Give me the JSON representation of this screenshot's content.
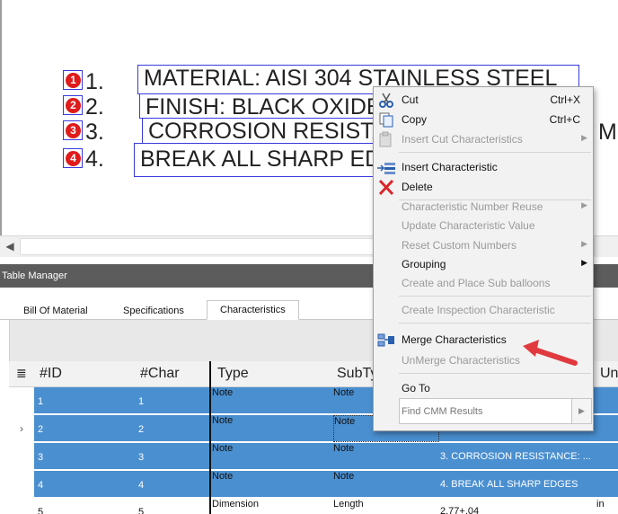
{
  "canvas": {
    "notes": [
      {
        "balloon": "1",
        "number": "1.",
        "text": "MATERIAL:  AISI 304 STAINLESS STEEL"
      },
      {
        "balloon": "2",
        "number": "2.",
        "text": "FINISH: BLACK OXIDE"
      },
      {
        "balloon": "3",
        "number": "3.",
        "text": "CORROSION RESISTANCE:"
      },
      {
        "balloon": "4",
        "number": "4.",
        "text": "BREAK ALL SHARP EDGES"
      }
    ],
    "hidden_tail": "MI"
  },
  "table_manager": {
    "title": "Table Manager",
    "tabs": [
      "Bill Of Material",
      "Specifications",
      "Characteristics"
    ],
    "active_tab": "Characteristics",
    "columns": [
      "#ID",
      "#Char",
      "Type",
      "SubTy",
      "Un"
    ],
    "rows": [
      {
        "id": "1",
        "char": "1",
        "type": "Note",
        "subtype": "Note",
        "text": "",
        "unit": ""
      },
      {
        "id": "2",
        "char": "2",
        "type": "Note",
        "subtype": "Note",
        "text": "",
        "unit": ""
      },
      {
        "id": "3",
        "char": "3",
        "type": "Note",
        "subtype": "Note",
        "text": "3. CORROSION RESISTANCE: ...",
        "unit": ""
      },
      {
        "id": "4",
        "char": "4",
        "type": "Note",
        "subtype": "Note",
        "text": "4. BREAK ALL SHARP EDGES",
        "unit": ""
      },
      {
        "id": "5",
        "char": "5",
        "type": "Dimension",
        "subtype": "Length",
        "text": "2.77+.04",
        "unit": "in"
      }
    ]
  },
  "context_menu": {
    "items": [
      {
        "label": "Cut",
        "shortcut": "Ctrl+X",
        "disabled": false
      },
      {
        "label": "Copy",
        "shortcut": "Ctrl+C",
        "disabled": false
      },
      {
        "label": "Insert Cut Characteristics",
        "disabled": true,
        "submenu": true
      },
      {
        "label": "Insert Characteristic",
        "disabled": false
      },
      {
        "label": "Delete",
        "disabled": false
      },
      {
        "label": "Characteristic Number Reuse",
        "disabled": true,
        "submenu": true
      },
      {
        "label": "Update Characteristic Value",
        "disabled": true
      },
      {
        "label": "Reset Custom Numbers",
        "disabled": true,
        "submenu": true
      },
      {
        "label": "Grouping",
        "disabled": false,
        "submenu": true
      },
      {
        "label": "Create and Place Sub balloons",
        "disabled": true
      },
      {
        "label": "Create Inspection Characteristic",
        "disabled": true
      },
      {
        "label": "Merge Characteristics",
        "disabled": false
      },
      {
        "label": "UnMerge Characteristics",
        "disabled": true
      },
      {
        "label": "Go To",
        "disabled": false
      }
    ],
    "find_placeholder": "Find CMM Results"
  },
  "colors": {
    "selection": "#4a8fd0",
    "balloon_red": "#e01b1b",
    "arrow_red": "#e0393e"
  }
}
